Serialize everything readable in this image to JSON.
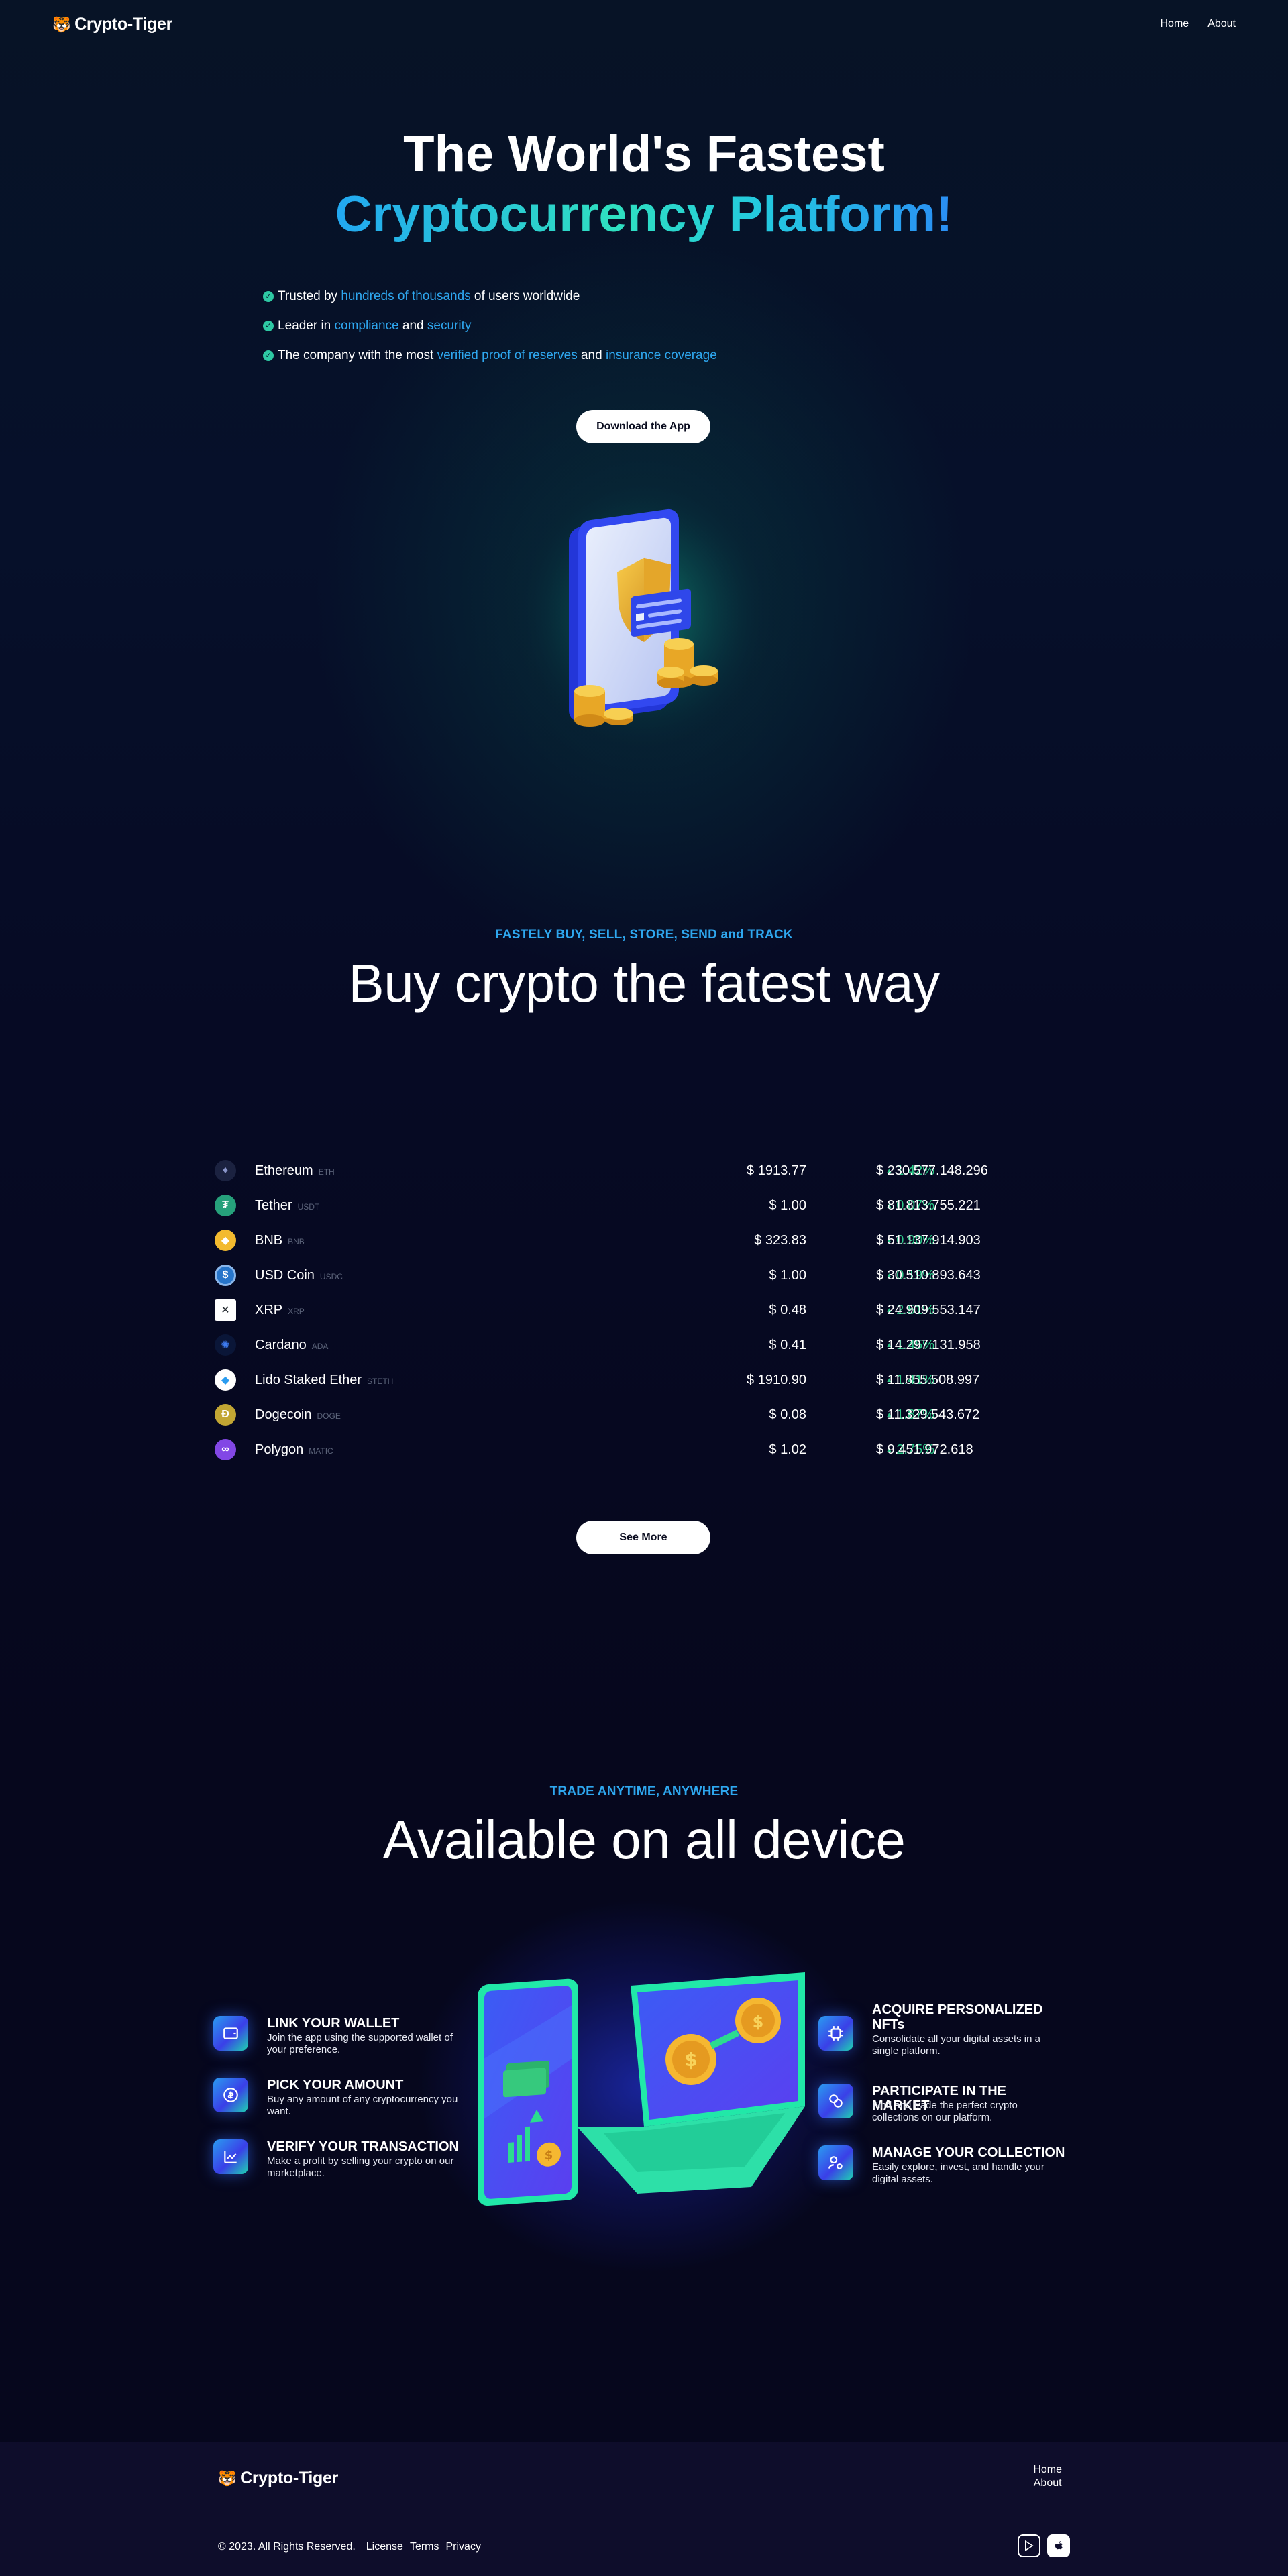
{
  "brand": {
    "name": "Crypto-Tiger"
  },
  "nav": {
    "home": "Home",
    "about": "About"
  },
  "hero": {
    "title_line1": "The World's Fastest",
    "title_line2": "Cryptocurrency Platform!",
    "bullets": [
      {
        "pre": "Trusted by ",
        "hl1": "hundreds of thousands",
        "mid": " of users worldwide",
        "hl2": ""
      },
      {
        "pre": "Leader in ",
        "hl1": "compliance",
        "mid": " and ",
        "hl2": "security"
      },
      {
        "pre": "The company with the most ",
        "hl1": "verified proof of reserves",
        "mid": " and ",
        "hl2": "insurance coverage"
      }
    ],
    "download_label": "Download the App"
  },
  "market": {
    "kicker": "FASTELY BUY, SELL, STORE, SEND and TRACK",
    "title": "Buy crypto the fatest way",
    "see_more_label": "See More",
    "coins": [
      {
        "name": "Ethereum",
        "symbol": "ETH",
        "price": "$ 1913.77",
        "change": "1.42%",
        "cap": "$ 230.577.148.296",
        "icon": "ethereum-icon",
        "color": "#1b2240"
      },
      {
        "name": "Tether",
        "symbol": "USDT",
        "price": "$ 1.00",
        "change": "0.07%",
        "cap": "$ 81.813.755.221",
        "icon": "tether-icon",
        "color": "#26a17b"
      },
      {
        "name": "BNB",
        "symbol": "BNB",
        "price": "$ 323.83",
        "change": "0.90%",
        "cap": "$ 51.137.914.903",
        "icon": "bnb-icon",
        "color": "#f3ba2f"
      },
      {
        "name": "USD Coin",
        "symbol": "USDC",
        "price": "$ 1.00",
        "change": "0.19%",
        "cap": "$ 30.510.893.643",
        "icon": "usdc-icon",
        "color": "#2775ca"
      },
      {
        "name": "XRP",
        "symbol": "XRP",
        "price": "$ 0.48",
        "change": "2.51%",
        "cap": "$ 24.909.553.147",
        "icon": "xrp-icon",
        "color": "#ffffff"
      },
      {
        "name": "Cardano",
        "symbol": "ADA",
        "price": "$ 0.41",
        "change": "1.45%",
        "cap": "$ 14.297.131.958",
        "icon": "cardano-icon",
        "color": "#0a1638"
      },
      {
        "name": "Lido Staked Ether",
        "symbol": "STETH",
        "price": "$ 1910.90",
        "change": "1.41%",
        "cap": "$ 11.855.508.997",
        "icon": "steth-icon",
        "color": "#ffffff"
      },
      {
        "name": "Dogecoin",
        "symbol": "DOGE",
        "price": "$ 0.08",
        "change": "1.87%",
        "cap": "$ 11.329.543.672",
        "icon": "dogecoin-icon",
        "color": "#c2a633"
      },
      {
        "name": "Polygon",
        "symbol": "MATIC",
        "price": "$ 1.02",
        "change": "2.75%",
        "cap": "$ 9.451.972.618",
        "icon": "polygon-icon",
        "color": "#8247e5"
      }
    ]
  },
  "devices": {
    "kicker": "TRADE ANYTIME, ANYWHERE",
    "title": "Available on all device",
    "features_left": [
      {
        "title": "LINK YOUR WALLET",
        "desc": "Join the app using the supported wallet of your preference.",
        "icon": "wallet-icon"
      },
      {
        "title": "PICK YOUR AMOUNT",
        "desc": "Buy any amount of any cryptocurrency you want.",
        "icon": "coin-dollar-icon"
      },
      {
        "title": "VERIFY YOUR TRANSACTION",
        "desc": "Make a profit by selling your crypto on our marketplace.",
        "icon": "chart-up-icon"
      }
    ],
    "features_right": [
      {
        "title": "ACQUIRE PERSONALIZED NFTs",
        "desc": "Consolidate all your digital assets in a single platform.",
        "icon": "chip-icon"
      },
      {
        "title": "PARTICIPATE IN THE MARKET",
        "desc": "Find and trade the perfect crypto collections on our platform.",
        "icon": "coins-exchange-icon"
      },
      {
        "title": "MANAGE YOUR COLLECTION",
        "desc": "Easily explore, invest, and handle your digital assets.",
        "icon": "user-settings-icon"
      }
    ]
  },
  "footer": {
    "home": "Home",
    "about": "About",
    "copyright": "© 2023. All Rights Reserved.",
    "license": "License",
    "terms": "Terms",
    "privacy": "Privacy"
  }
}
